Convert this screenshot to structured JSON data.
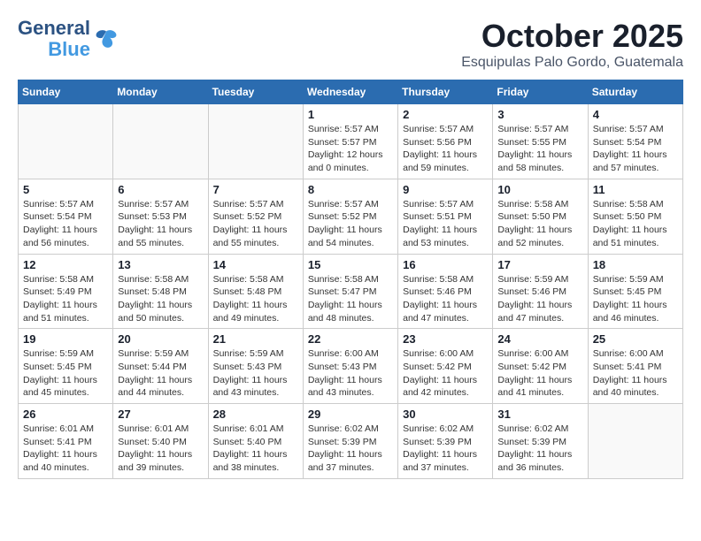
{
  "header": {
    "logo_line1": "General",
    "logo_line2": "Blue",
    "month": "October 2025",
    "location": "Esquipulas Palo Gordo, Guatemala"
  },
  "weekdays": [
    "Sunday",
    "Monday",
    "Tuesday",
    "Wednesday",
    "Thursday",
    "Friday",
    "Saturday"
  ],
  "weeks": [
    [
      {
        "day": "",
        "info": ""
      },
      {
        "day": "",
        "info": ""
      },
      {
        "day": "",
        "info": ""
      },
      {
        "day": "1",
        "info": "Sunrise: 5:57 AM\nSunset: 5:57 PM\nDaylight: 12 hours\nand 0 minutes."
      },
      {
        "day": "2",
        "info": "Sunrise: 5:57 AM\nSunset: 5:56 PM\nDaylight: 11 hours\nand 59 minutes."
      },
      {
        "day": "3",
        "info": "Sunrise: 5:57 AM\nSunset: 5:55 PM\nDaylight: 11 hours\nand 58 minutes."
      },
      {
        "day": "4",
        "info": "Sunrise: 5:57 AM\nSunset: 5:54 PM\nDaylight: 11 hours\nand 57 minutes."
      }
    ],
    [
      {
        "day": "5",
        "info": "Sunrise: 5:57 AM\nSunset: 5:54 PM\nDaylight: 11 hours\nand 56 minutes."
      },
      {
        "day": "6",
        "info": "Sunrise: 5:57 AM\nSunset: 5:53 PM\nDaylight: 11 hours\nand 55 minutes."
      },
      {
        "day": "7",
        "info": "Sunrise: 5:57 AM\nSunset: 5:52 PM\nDaylight: 11 hours\nand 55 minutes."
      },
      {
        "day": "8",
        "info": "Sunrise: 5:57 AM\nSunset: 5:52 PM\nDaylight: 11 hours\nand 54 minutes."
      },
      {
        "day": "9",
        "info": "Sunrise: 5:57 AM\nSunset: 5:51 PM\nDaylight: 11 hours\nand 53 minutes."
      },
      {
        "day": "10",
        "info": "Sunrise: 5:58 AM\nSunset: 5:50 PM\nDaylight: 11 hours\nand 52 minutes."
      },
      {
        "day": "11",
        "info": "Sunrise: 5:58 AM\nSunset: 5:50 PM\nDaylight: 11 hours\nand 51 minutes."
      }
    ],
    [
      {
        "day": "12",
        "info": "Sunrise: 5:58 AM\nSunset: 5:49 PM\nDaylight: 11 hours\nand 51 minutes."
      },
      {
        "day": "13",
        "info": "Sunrise: 5:58 AM\nSunset: 5:48 PM\nDaylight: 11 hours\nand 50 minutes."
      },
      {
        "day": "14",
        "info": "Sunrise: 5:58 AM\nSunset: 5:48 PM\nDaylight: 11 hours\nand 49 minutes."
      },
      {
        "day": "15",
        "info": "Sunrise: 5:58 AM\nSunset: 5:47 PM\nDaylight: 11 hours\nand 48 minutes."
      },
      {
        "day": "16",
        "info": "Sunrise: 5:58 AM\nSunset: 5:46 PM\nDaylight: 11 hours\nand 47 minutes."
      },
      {
        "day": "17",
        "info": "Sunrise: 5:59 AM\nSunset: 5:46 PM\nDaylight: 11 hours\nand 47 minutes."
      },
      {
        "day": "18",
        "info": "Sunrise: 5:59 AM\nSunset: 5:45 PM\nDaylight: 11 hours\nand 46 minutes."
      }
    ],
    [
      {
        "day": "19",
        "info": "Sunrise: 5:59 AM\nSunset: 5:45 PM\nDaylight: 11 hours\nand 45 minutes."
      },
      {
        "day": "20",
        "info": "Sunrise: 5:59 AM\nSunset: 5:44 PM\nDaylight: 11 hours\nand 44 minutes."
      },
      {
        "day": "21",
        "info": "Sunrise: 5:59 AM\nSunset: 5:43 PM\nDaylight: 11 hours\nand 43 minutes."
      },
      {
        "day": "22",
        "info": "Sunrise: 6:00 AM\nSunset: 5:43 PM\nDaylight: 11 hours\nand 43 minutes."
      },
      {
        "day": "23",
        "info": "Sunrise: 6:00 AM\nSunset: 5:42 PM\nDaylight: 11 hours\nand 42 minutes."
      },
      {
        "day": "24",
        "info": "Sunrise: 6:00 AM\nSunset: 5:42 PM\nDaylight: 11 hours\nand 41 minutes."
      },
      {
        "day": "25",
        "info": "Sunrise: 6:00 AM\nSunset: 5:41 PM\nDaylight: 11 hours\nand 40 minutes."
      }
    ],
    [
      {
        "day": "26",
        "info": "Sunrise: 6:01 AM\nSunset: 5:41 PM\nDaylight: 11 hours\nand 40 minutes."
      },
      {
        "day": "27",
        "info": "Sunrise: 6:01 AM\nSunset: 5:40 PM\nDaylight: 11 hours\nand 39 minutes."
      },
      {
        "day": "28",
        "info": "Sunrise: 6:01 AM\nSunset: 5:40 PM\nDaylight: 11 hours\nand 38 minutes."
      },
      {
        "day": "29",
        "info": "Sunrise: 6:02 AM\nSunset: 5:39 PM\nDaylight: 11 hours\nand 37 minutes."
      },
      {
        "day": "30",
        "info": "Sunrise: 6:02 AM\nSunset: 5:39 PM\nDaylight: 11 hours\nand 37 minutes."
      },
      {
        "day": "31",
        "info": "Sunrise: 6:02 AM\nSunset: 5:39 PM\nDaylight: 11 hours\nand 36 minutes."
      },
      {
        "day": "",
        "info": ""
      }
    ]
  ]
}
